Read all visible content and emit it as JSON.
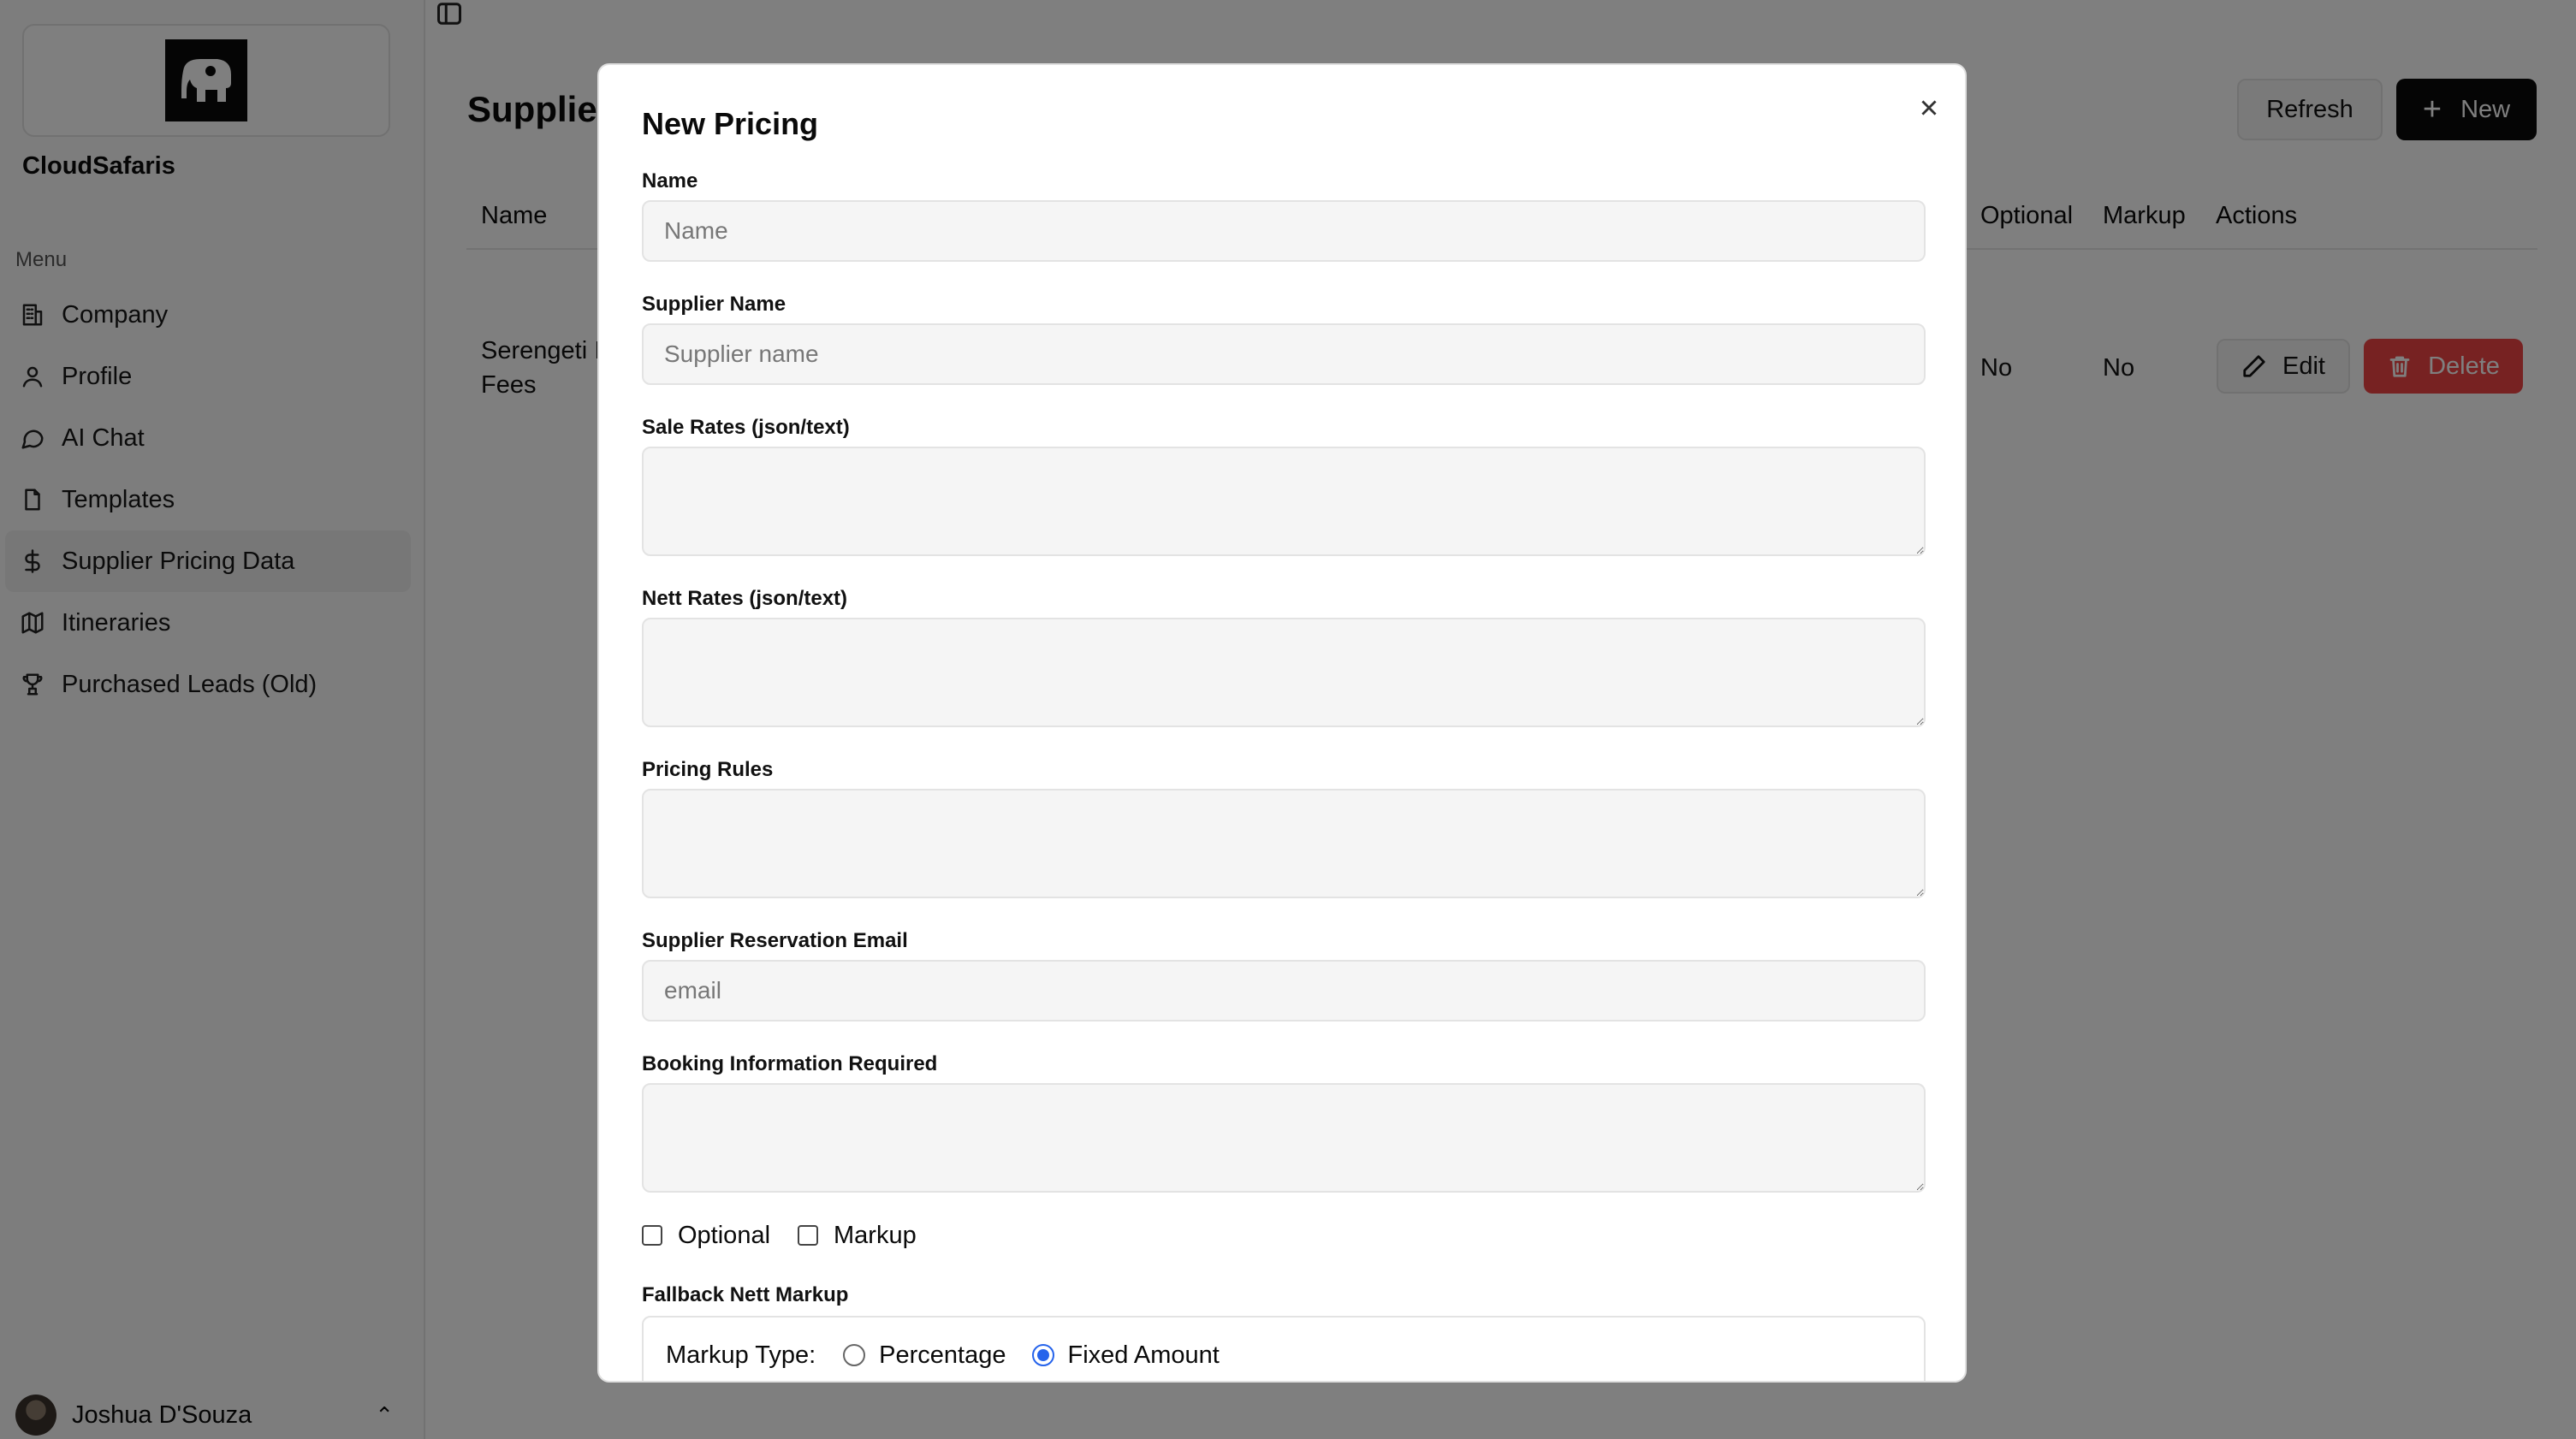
{
  "sidebar": {
    "company_name": "CloudSafaris",
    "menu_label": "Menu",
    "items": [
      {
        "label": "Company",
        "icon": "building-icon"
      },
      {
        "label": "Profile",
        "icon": "user-icon"
      },
      {
        "label": "AI Chat",
        "icon": "message-circle-icon"
      },
      {
        "label": "Templates",
        "icon": "file-icon"
      },
      {
        "label": "Supplier Pricing Data",
        "icon": "dollar-icon",
        "active": true
      },
      {
        "label": "Itineraries",
        "icon": "map-icon"
      },
      {
        "label": "Purchased Leads (Old)",
        "icon": "trophy-icon"
      }
    ],
    "user_name": "Joshua D'Souza"
  },
  "main": {
    "title": "Supplier",
    "refresh_label": "Refresh",
    "new_label": "New",
    "table": {
      "headers": {
        "name": "Name",
        "optional": "Optional",
        "markup": "Markup",
        "actions": "Actions"
      },
      "rows": [
        {
          "name_line1": "Serengeti I",
          "name_line2": "Fees",
          "optional": "No",
          "markup": "No",
          "edit_label": "Edit",
          "delete_label": "Delete"
        }
      ]
    }
  },
  "dialog": {
    "title": "New Pricing",
    "name_label": "Name",
    "name_placeholder": "Name",
    "supplier_label": "Supplier Name",
    "supplier_placeholder": "Supplier name",
    "sale_rates_label": "Sale Rates (json/text)",
    "nett_rates_label": "Nett Rates (json/text)",
    "pricing_rules_label": "Pricing Rules",
    "email_label": "Supplier Reservation Email",
    "email_placeholder": "email",
    "booking_info_label": "Booking Information Required",
    "optional_label": "Optional",
    "markup_label": "Markup",
    "fallback_label": "Fallback Nett Markup",
    "markup_type_label": "Markup Type:",
    "percentage_label": "Percentage",
    "fixed_label": "Fixed Amount",
    "markup_type_selected": "Fixed Amount"
  },
  "colors": {
    "accent": "#2563eb",
    "danger": "#ef4444",
    "primary": "#0a0a0a"
  }
}
